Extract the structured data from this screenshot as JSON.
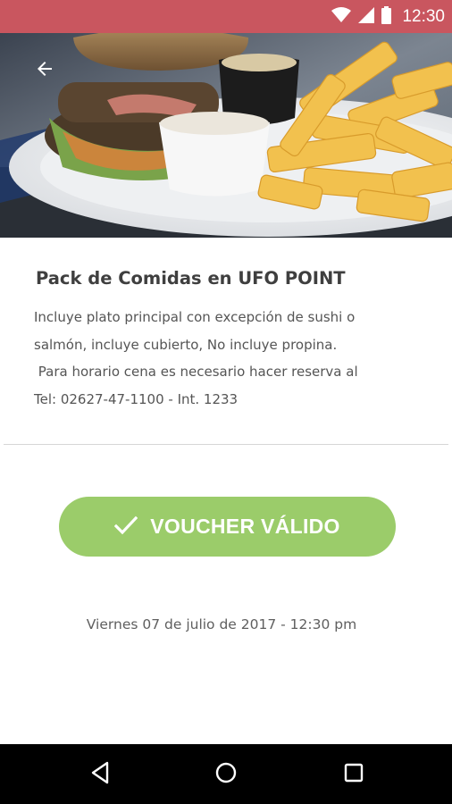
{
  "status_bar": {
    "time": "12:30",
    "color": "#c9565f",
    "icons": [
      "wifi-icon",
      "signal-icon",
      "battery-icon"
    ]
  },
  "header": {
    "back_icon": "arrow-left-icon",
    "image": "burger-and-fries-photo"
  },
  "offer": {
    "title": "Pack de Comidas en UFO POINT",
    "description_lines": [
      "Incluye plato principal con excepción de sushi o",
      "salmón, incluye cubierto, No incluye propina.",
      " Para horario cena es necesario hacer reserva al",
      "Tel: 02627-47-1100 - Int. 1233"
    ]
  },
  "voucher": {
    "label": "VOUCHER VÁLIDO",
    "icon": "checkmark-icon",
    "color": "#9bcc6a"
  },
  "date": "Viernes 07 de julio de 2017 - 12:30 pm",
  "nav_bar": {
    "icons": [
      "back-triangle-icon",
      "home-circle-icon",
      "recents-square-icon"
    ]
  }
}
